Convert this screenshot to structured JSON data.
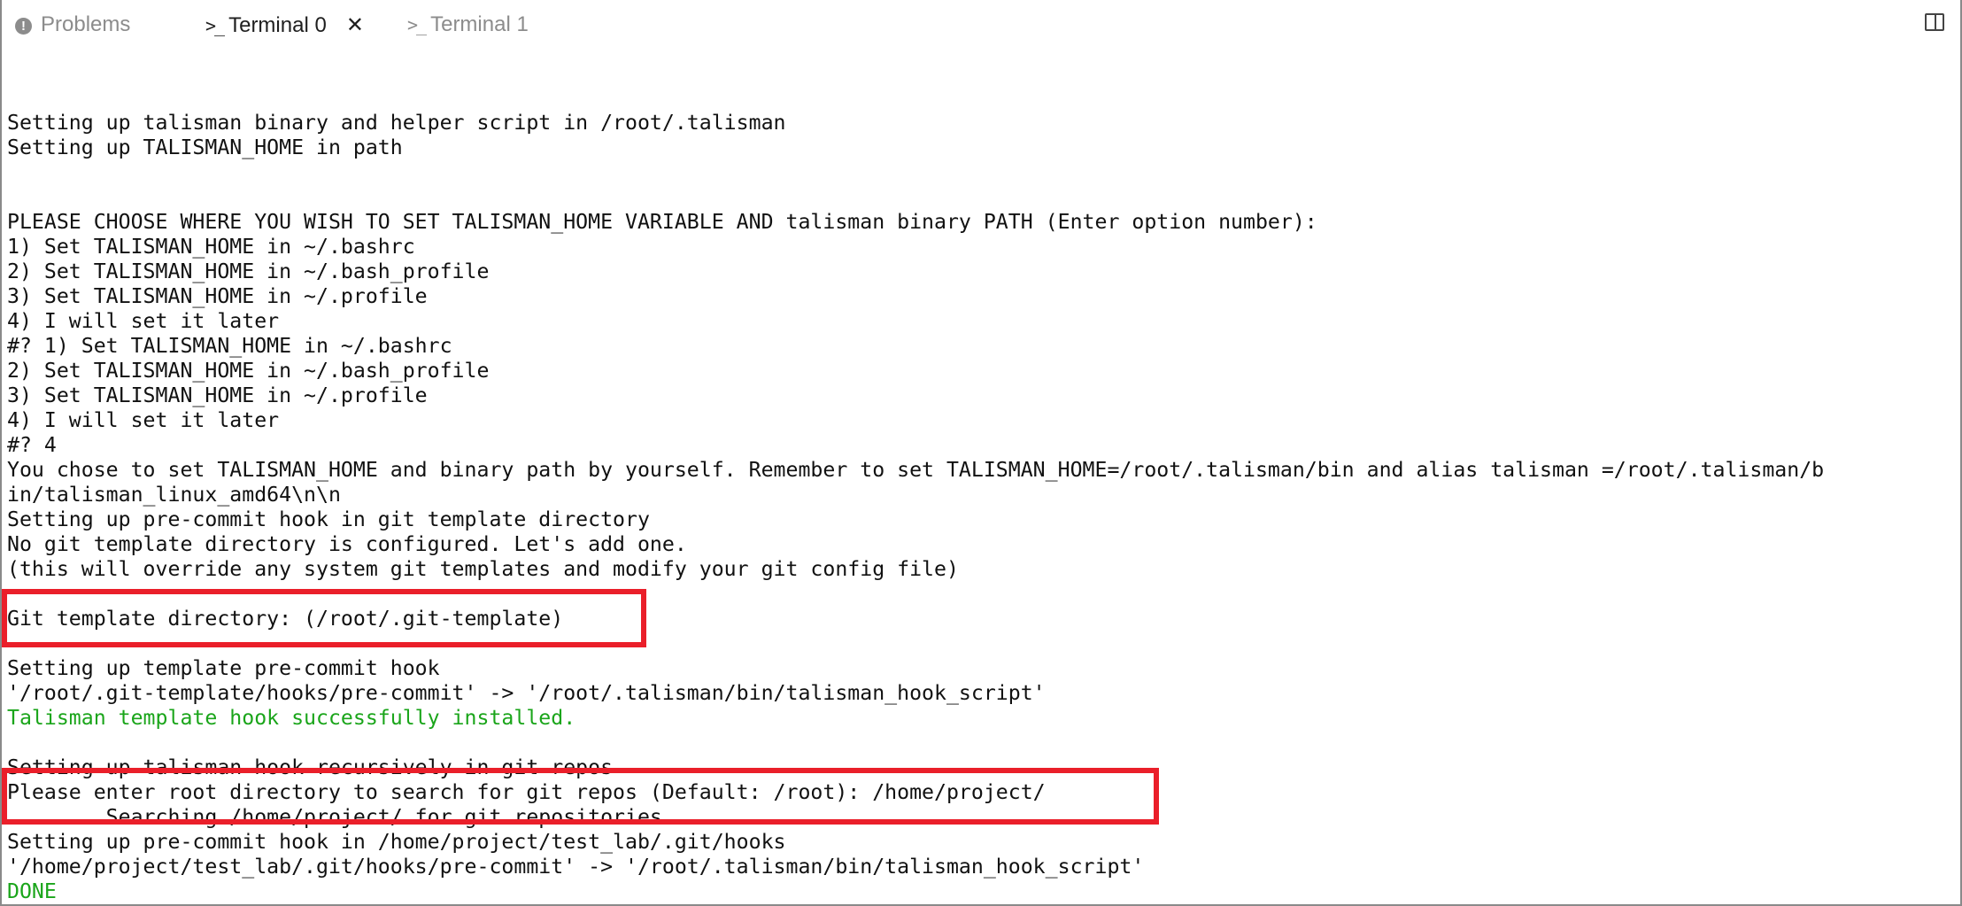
{
  "tabs": {
    "problems": "Problems",
    "terminal0": "Terminal 0",
    "terminal1": "Terminal 1"
  },
  "icons": {
    "problems": "warning-circle-icon",
    "terminal": "terminal-prompt-icon",
    "close": "close-icon",
    "split": "split-panel-icon"
  },
  "colors": {
    "highlight_box": "#ea1f2a",
    "success_text": "#1aa51a"
  },
  "terminal": {
    "lines": [
      "Setting up talisman binary and helper script in /root/.talisman",
      "Setting up TALISMAN_HOME in path",
      "",
      "",
      "PLEASE CHOOSE WHERE YOU WISH TO SET TALISMAN_HOME VARIABLE AND talisman binary PATH (Enter option number):",
      "1) Set TALISMAN_HOME in ~/.bashrc",
      "2) Set TALISMAN_HOME in ~/.bash_profile",
      "3) Set TALISMAN_HOME in ~/.profile",
      "4) I will set it later",
      "#? 1) Set TALISMAN_HOME in ~/.bashrc",
      "2) Set TALISMAN_HOME in ~/.bash_profile",
      "3) Set TALISMAN_HOME in ~/.profile",
      "4) I will set it later",
      "#? 4",
      "You chose to set TALISMAN_HOME and binary path by yourself. Remember to set TALISMAN_HOME=/root/.talisman/bin and alias talisman =/root/.talisman/b",
      "in/talisman_linux_amd64\\n\\n",
      "Setting up pre-commit hook in git template directory",
      "No git template directory is configured. Let's add one.",
      "(this will override any system git templates and modify your git config file)",
      "",
      "Git template directory: (/root/.git-template)",
      "",
      "Setting up template pre-commit hook",
      "'/root/.git-template/hooks/pre-commit' -> '/root/.talisman/bin/talisman_hook_script'",
      "Talisman template hook successfully installed.",
      "",
      "Setting up talisman hook recursively in git repos",
      "Please enter root directory to search for git repos (Default: /root): /home/project/",
      "        Searching /home/project/ for git repositories",
      "Setting up pre-commit hook in /home/project/test_lab/.git/hooks",
      "'/home/project/test_lab/.git/hooks/pre-commit' -> '/root/.talisman/bin/talisman_hook_script'",
      "DONE"
    ]
  }
}
